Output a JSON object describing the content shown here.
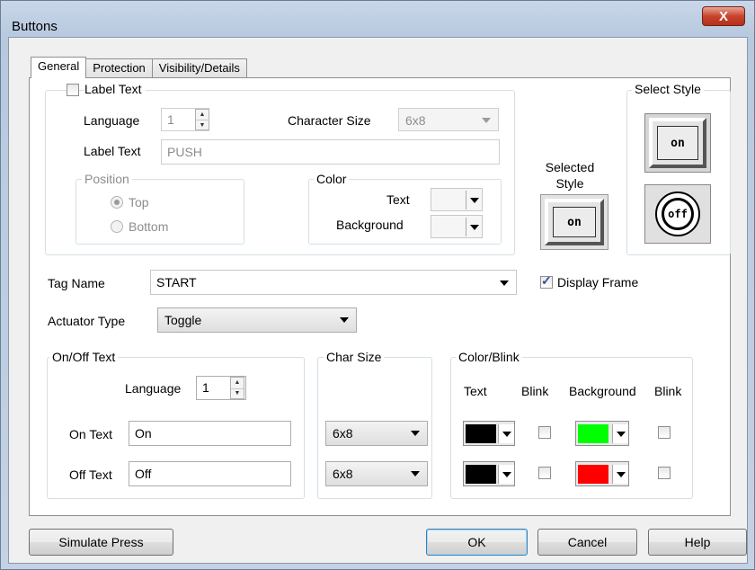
{
  "window": {
    "title": "Buttons",
    "close_label": "X"
  },
  "tabs": [
    "General",
    "Protection",
    "Visibility/Details"
  ],
  "label_text": {
    "checkbox_label": "Label Text",
    "checked": false,
    "language_label": "Language",
    "language_value": "1",
    "char_size_label": "Character Size",
    "char_size_value": "6x8",
    "label_text_label": "Label Text",
    "label_text_value": "PUSH",
    "position": {
      "title": "Position",
      "top": "Top",
      "bottom": "Bottom",
      "selected": "Top"
    },
    "color": {
      "title": "Color",
      "text_label": "Text",
      "background_label": "Background"
    }
  },
  "style": {
    "selected_title": "Selected Style",
    "select_title": "Select Style",
    "selected_btn_label": "on",
    "option1_label": "on",
    "option2_label": "off"
  },
  "tag": {
    "label": "Tag Name",
    "value": "START",
    "display_frame_label": "Display Frame",
    "display_frame_checked": true
  },
  "actuator": {
    "label": "Actuator Type",
    "value": "Toggle"
  },
  "onoff": {
    "title": "On/Off Text",
    "language_label": "Language",
    "language_value": "1",
    "on_label": "On Text",
    "on_value": "On",
    "off_label": "Off Text",
    "off_value": "Off"
  },
  "char_size": {
    "title": "Char Size",
    "on_value": "6x8",
    "off_value": "6x8"
  },
  "color_blink": {
    "title": "Color/Blink",
    "col_text": "Text",
    "col_blink": "Blink",
    "col_background": "Background",
    "col_blink2": "Blink",
    "on_text_color": "#000000",
    "on_bg_color": "#00ff00",
    "off_text_color": "#000000",
    "off_bg_color": "#ff0000"
  },
  "footer": {
    "simulate": "Simulate Press",
    "ok": "OK",
    "cancel": "Cancel",
    "help": "Help"
  }
}
